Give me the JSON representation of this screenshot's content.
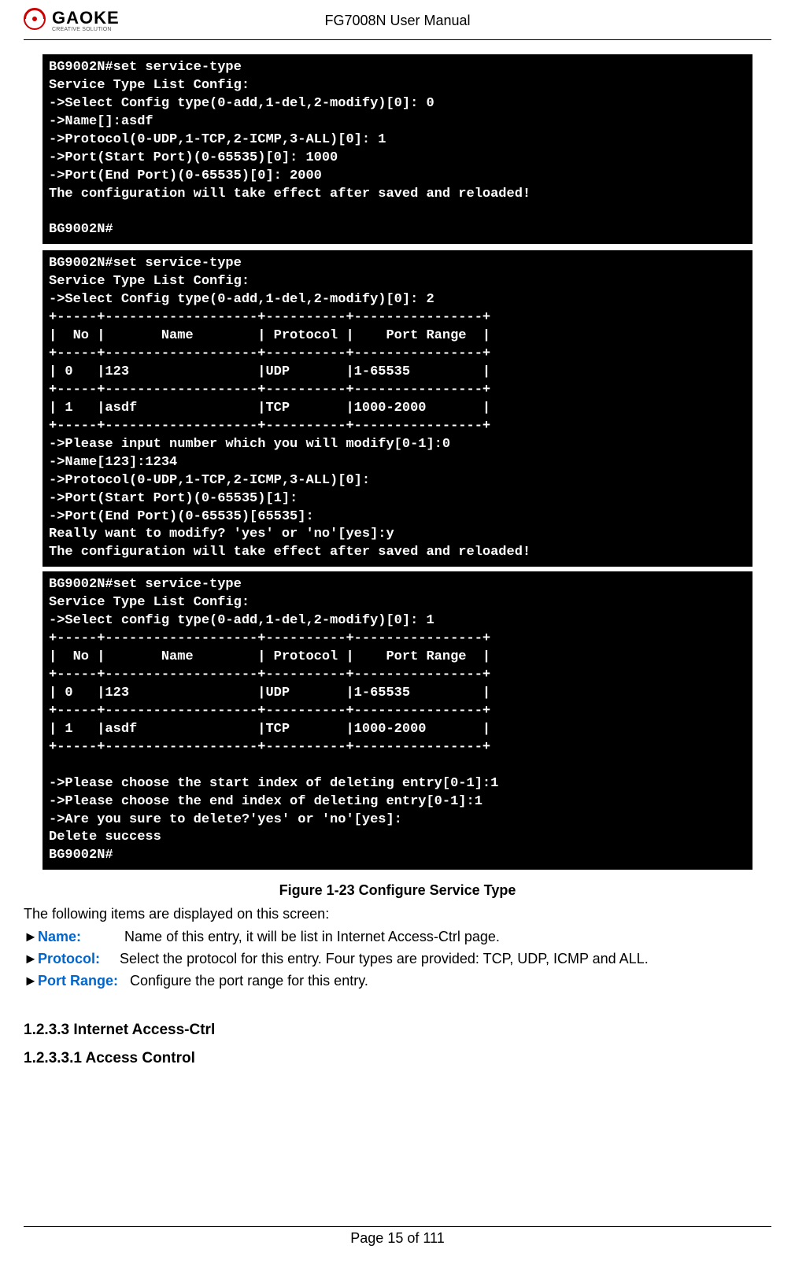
{
  "header": {
    "logo_main": "GAOKE",
    "logo_sub": "CREATIVE SOLUTION",
    "doc_title": "FG7008N User Manual"
  },
  "terminals": {
    "t1": "BG9002N#set service-type\nService Type List Config:\n->Select Config type(0-add,1-del,2-modify)[0]: 0\n->Name[]:asdf\n->Protocol(0-UDP,1-TCP,2-ICMP,3-ALL)[0]: 1\n->Port(Start Port)(0-65535)[0]: 1000\n->Port(End Port)(0-65535)[0]: 2000\nThe configuration will take effect after saved and reloaded!\n\nBG9002N#",
    "t2": "BG9002N#set service-type\nService Type List Config:\n->Select Config type(0-add,1-del,2-modify)[0]: 2\n+-----+-------------------+----------+----------------+\n|  No |       Name        | Protocol |    Port Range  |\n+-----+-------------------+----------+----------------+\n| 0   |123                |UDP       |1-65535         |\n+-----+-------------------+----------+----------------+\n| 1   |asdf               |TCP       |1000-2000       |\n+-----+-------------------+----------+----------------+\n->Please input number which you will modify[0-1]:0\n->Name[123]:1234\n->Protocol(0-UDP,1-TCP,2-ICMP,3-ALL)[0]:\n->Port(Start Port)(0-65535)[1]:\n->Port(End Port)(0-65535)[65535]:\nReally want to modify? 'yes' or 'no'[yes]:y\nThe configuration will take effect after saved and reloaded!",
    "t3": "BG9002N#set service-type\nService Type List Config:\n->Select config type(0-add,1-del,2-modify)[0]: 1\n+-----+-------------------+----------+----------------+\n|  No |       Name        | Protocol |    Port Range  |\n+-----+-------------------+----------+----------------+\n| 0   |123                |UDP       |1-65535         |\n+-----+-------------------+----------+----------------+\n| 1   |asdf               |TCP       |1000-2000       |\n+-----+-------------------+----------+----------------+\n\n->Please choose the start index of deleting entry[0-1]:1\n->Please choose the end index of deleting entry[0-1]:1\n->Are you sure to delete?'yes' or 'no'[yes]:\nDelete success\nBG9002N#"
  },
  "figure_caption": "Figure 1-23   Configure Service Type",
  "intro_line": "The following items are displayed on this screen:",
  "def_arrow": "►",
  "defs": {
    "name_label": "Name:",
    "name_desc": "Name of this entry, it will be list in Internet Access-Ctrl page.",
    "protocol_label": "Protocol:",
    "protocol_desc": "Select the protocol for this entry. Four types are provided: TCP, UDP, ICMP and ALL.",
    "portrange_label": "Port Range:",
    "portrange_desc": "Configure the port range for this entry."
  },
  "heading_1": "1.2.3.3    Internet Access-Ctrl",
  "heading_2": "1.2.3.3.1     Access Control",
  "footer_text": "Page 15 of 111"
}
